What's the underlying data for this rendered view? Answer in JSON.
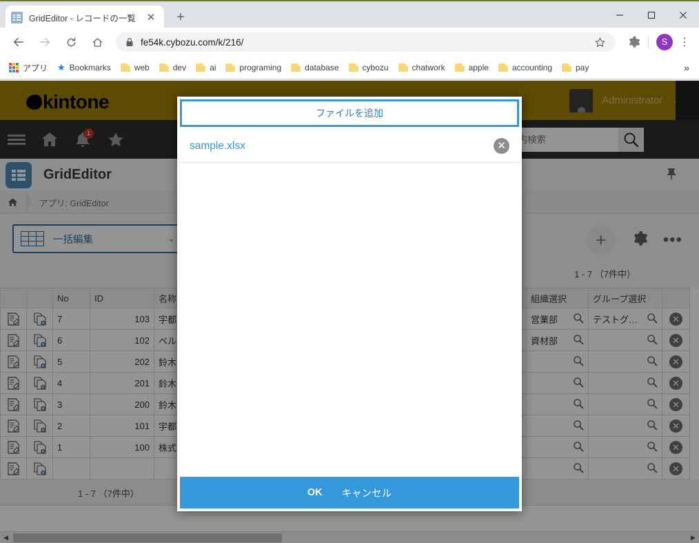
{
  "browser": {
    "tab": {
      "title": "GridEditor - レコードの一覧",
      "favicon": "grid-icon",
      "close_label": "✕"
    },
    "new_tab_label": "+",
    "window_controls": {
      "minimize": "minimize-icon",
      "maximize": "maximize-icon",
      "close": "close-icon"
    },
    "nav": {
      "back": "back-arrow-icon",
      "forward": "forward-arrow-icon",
      "reload": "reload-icon",
      "home": "home-icon"
    },
    "omnibox": {
      "url": "fe54k.cybozu.com/k/216/",
      "lock": "lock-icon",
      "bookmark_star": "star-icon"
    },
    "profile_initial": "S",
    "menu_label": "⋮",
    "bookmarks": [
      {
        "label": "アプリ",
        "icon": "apps-grid-icon"
      },
      {
        "label": "Bookmarks",
        "icon": "star-icon"
      },
      {
        "label": "web",
        "icon": "folder-icon"
      },
      {
        "label": "dev",
        "icon": "folder-icon"
      },
      {
        "label": "ai",
        "icon": "folder-icon"
      },
      {
        "label": "programing",
        "icon": "folder-icon"
      },
      {
        "label": "database",
        "icon": "folder-icon"
      },
      {
        "label": "cybozu",
        "icon": "folder-icon"
      },
      {
        "label": "chatwork",
        "icon": "folder-icon"
      },
      {
        "label": "apple",
        "icon": "folder-icon"
      },
      {
        "label": "accounting",
        "icon": "folder-icon"
      },
      {
        "label": "pay",
        "icon": "folder-icon"
      }
    ],
    "bookmarks_overflow": "»"
  },
  "kintone": {
    "brand": "kintone",
    "user_name": "Administrator",
    "user_chevron": "⌄",
    "nav_icons": [
      "menu-icon",
      "home-icon",
      "bell-icon",
      "star-icon"
    ],
    "notification_count": "1",
    "search_placeholder": "アプリ内検索",
    "app_title": "GridEditor",
    "breadcrumb": "アプリ: GridEditor",
    "bulk_edit_label": "一括編集",
    "record_count_top": "1 - 7 （7件中）",
    "record_count_bottom": "1 - 7 （7件中）",
    "toolbar": {
      "add": "+",
      "settings": "gear-icon",
      "more": "•••",
      "pin": "pin-icon"
    }
  },
  "table": {
    "columns": [
      "",
      "",
      "No",
      "ID",
      "名称",
      "",
      "組織選択",
      "グループ選択",
      ""
    ],
    "rows": [
      {
        "no": "7",
        "id": "103",
        "name": "宇都",
        "org": "営業部",
        "group": "テストグ…"
      },
      {
        "no": "6",
        "id": "102",
        "name": "ベル",
        "org": "資材部",
        "group": ""
      },
      {
        "no": "5",
        "id": "202",
        "name": "鈴木",
        "org": "",
        "group": ""
      },
      {
        "no": "4",
        "id": "201",
        "name": "鈴木",
        "org": "",
        "group": ""
      },
      {
        "no": "3",
        "id": "200",
        "name": "鈴木",
        "org": "",
        "group": ""
      },
      {
        "no": "2",
        "id": "101",
        "name": "宇都",
        "org": "",
        "group": ""
      },
      {
        "no": "1",
        "id": "100",
        "name": "株式",
        "org": "",
        "group": ""
      },
      {
        "no": "",
        "id": "",
        "name": "",
        "org": "",
        "group": ""
      }
    ]
  },
  "modal": {
    "add_file_label": "ファイルを追加",
    "files": [
      {
        "name": "sample.xlsx",
        "delete_label": "✕"
      }
    ],
    "ok_label": "OK",
    "cancel_label": "キャンセル"
  },
  "colors": {
    "kintone_header": "#9f8100",
    "kintone_nav": "#2e2e2e",
    "modal_accent": "#3498db",
    "link_blue": "#3498db",
    "chrome_bg": "#dee1e6"
  }
}
